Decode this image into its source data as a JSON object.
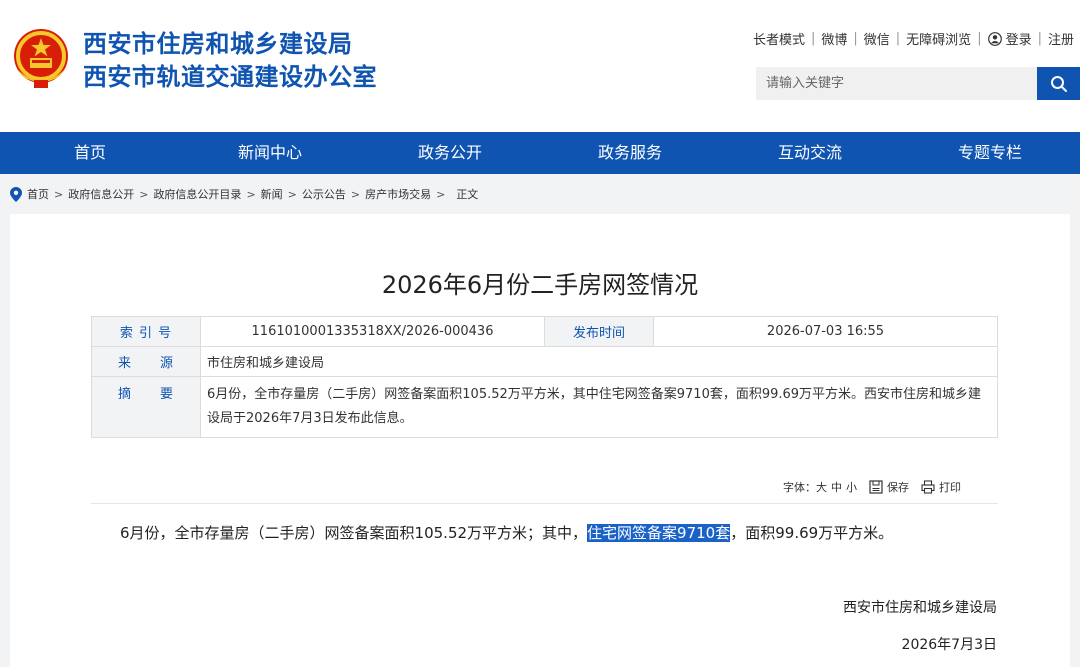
{
  "header": {
    "title_line1": "西安市住房和城乡建设局",
    "title_line2": "西安市轨道交通建设办公室",
    "brand_color": "#0f54b1",
    "emblem_icon": "national-emblem-icon",
    "toplinks": {
      "elder_mode": "长者模式",
      "weibo": "微博",
      "wechat": "微信",
      "accessible": "无障碍浏览",
      "login": "登录",
      "register": "注册"
    },
    "search": {
      "placeholder": "请输入关键字",
      "icon": "search-icon"
    }
  },
  "nav": {
    "items": [
      "首页",
      "新闻中心",
      "政务公开",
      "政务服务",
      "互动交流",
      "专题专栏"
    ]
  },
  "breadcrumb": {
    "icon": "location-pin-icon",
    "items": [
      "首页",
      "政府信息公开",
      "政府信息公开目录",
      "新闻",
      "公示公告",
      "房产市场交易"
    ],
    "current": "正文"
  },
  "article": {
    "title": "2026年6月份二手房网签情况",
    "meta": {
      "index_label": "索 引 号",
      "index_value": "1161010001335318XX/2026-000436",
      "publish_label": "发布时间",
      "publish_value": "2026-07-03 16:55",
      "source_label": "来　　源",
      "source_value": "市住房和城乡建设局",
      "abstract_label": "摘　　要",
      "abstract_value": "6月份，全市存量房（二手房）网签备案面积105.52万平方米，其中住宅网签备案9710套，面积99.69万平方米。西安市住房和城乡建设局于2026年7月3日发布此信息。"
    },
    "tools": {
      "font_label": "字体：",
      "size_large": "大",
      "size_medium": "中",
      "size_small": "小",
      "save": "保存",
      "print": "打印"
    },
    "body": {
      "part1": "6月份，全市存量房（二手房）网签备案面积105.52万平方米；其中，",
      "highlight": "住宅网签备案9710套",
      "part2": "，面积99.69万平方米。"
    },
    "signature_org": "西安市住房和城乡建设局",
    "signature_date": "2026年7月3日"
  }
}
